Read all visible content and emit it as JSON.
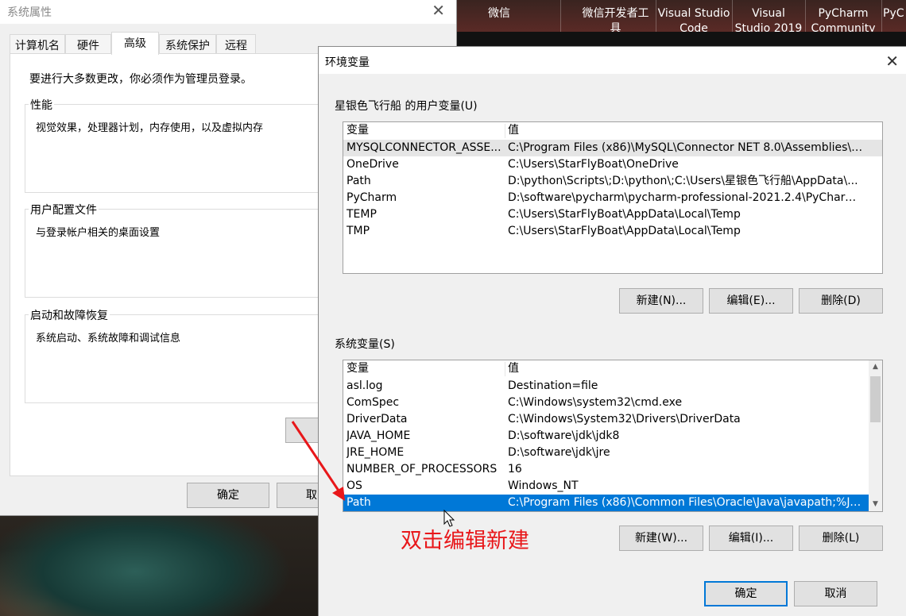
{
  "taskbar": {
    "items": [
      {
        "label": "微信"
      },
      {
        "label": "微信开发者工具"
      },
      {
        "label": "Visual Studio Code"
      },
      {
        "label": "Visual Studio 2019"
      },
      {
        "label": "PyCharm Community E"
      },
      {
        "label": "PyC"
      }
    ]
  },
  "system_properties": {
    "title": "系统属性",
    "tabs": [
      {
        "label": "计算机名"
      },
      {
        "label": "硬件"
      },
      {
        "label": "高级"
      },
      {
        "label": "系统保护"
      },
      {
        "label": "远程"
      }
    ],
    "active_tab": "高级",
    "admin_note": "要进行大多数更改，你必须作为管理员登录。",
    "groups": [
      {
        "title": "性能",
        "description": "视觉效果，处理器计划，内存使用，以及虚拟内存"
      },
      {
        "title": "用户配置文件",
        "description": "与登录帐户相关的桌面设置"
      },
      {
        "title": "启动和故障恢复",
        "description": "系统启动、系统故障和调试信息"
      }
    ],
    "ok_label": "确定",
    "cancel_label": "取"
  },
  "env_dialog": {
    "title": "环境变量",
    "user_section_label": "星银色飞行船 的用户变量(U)",
    "columns": {
      "name": "变量",
      "value": "值"
    },
    "user_vars": [
      {
        "name": "MYSQLCONNECTOR_ASSE...",
        "value": "C:\\Program Files (x86)\\MySQL\\Connector NET 8.0\\Assemblies\\v..."
      },
      {
        "name": "OneDrive",
        "value": "C:\\Users\\StarFlyBoat\\OneDrive"
      },
      {
        "name": "Path",
        "value": "D:\\python\\Scripts\\;D:\\python\\;C:\\Users\\星银色飞行船\\AppData\\..."
      },
      {
        "name": "PyCharm",
        "value": "D:\\software\\pycharm\\pycharm-professional-2021.2.4\\PyCharm ..."
      },
      {
        "name": "TEMP",
        "value": "C:\\Users\\StarFlyBoat\\AppData\\Local\\Temp"
      },
      {
        "name": "TMP",
        "value": "C:\\Users\\StarFlyBoat\\AppData\\Local\\Temp"
      }
    ],
    "user_buttons": {
      "new": "新建(N)...",
      "edit": "编辑(E)...",
      "delete": "删除(D)"
    },
    "system_section_label": "系统变量(S)",
    "system_vars": [
      {
        "name": "asl.log",
        "value": "Destination=file"
      },
      {
        "name": "ComSpec",
        "value": "C:\\Windows\\system32\\cmd.exe"
      },
      {
        "name": "DriverData",
        "value": "C:\\Windows\\System32\\Drivers\\DriverData"
      },
      {
        "name": "JAVA_HOME",
        "value": "D:\\software\\jdk\\jdk8"
      },
      {
        "name": "JRE_HOME",
        "value": "D:\\software\\jdk\\jre"
      },
      {
        "name": "NUMBER_OF_PROCESSORS",
        "value": "16"
      },
      {
        "name": "OS",
        "value": "Windows_NT"
      },
      {
        "name": "Path",
        "value": "C:\\Program Files (x86)\\Common Files\\Oracle\\Java\\javapath;%JA..."
      }
    ],
    "system_buttons": {
      "new": "新建(W)...",
      "edit": "编辑(I)...",
      "delete": "删除(L)"
    },
    "ok_label": "确定",
    "cancel_label": "取消"
  },
  "annotation_text": "双击编辑新建",
  "colors": {
    "selection": "#0078d7",
    "annotation": "#e8171a",
    "primary_border": "#0078d7"
  }
}
